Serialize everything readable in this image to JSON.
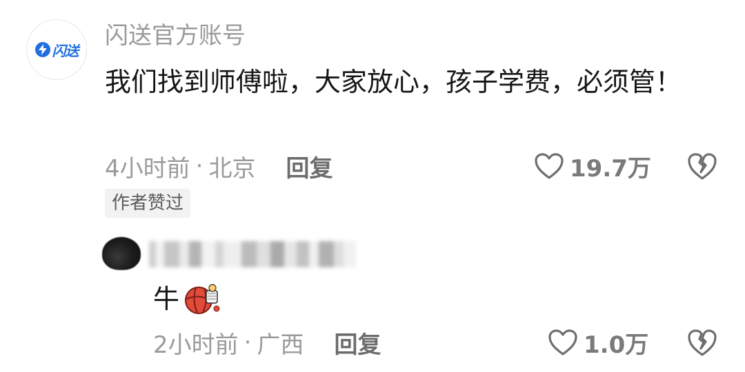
{
  "comment": {
    "avatar": {
      "icon": "shansong-logo-icon",
      "logo_text": "闪送",
      "brand_color": "#1f6fe0"
    },
    "username": "闪送官方账号",
    "text": "我们找到师傅啦，大家放心，孩子学费，必须管！",
    "time": "4小时前",
    "separator": "·",
    "location": "北京",
    "reply_label": "回复",
    "like_icon": "heart-outline-icon",
    "like_count": "19.7万",
    "dislike_icon": "broken-heart-icon",
    "author_badge": "作者赞过"
  },
  "reply": {
    "avatar_icon": "blurred-avatar",
    "username_blurred": true,
    "text": "牛",
    "emoji": "basketball-dunk-emoji",
    "time": "2小时前",
    "separator": "·",
    "location": "广西",
    "reply_label": "回复",
    "like_icon": "heart-outline-icon",
    "like_count": "1.0万",
    "dislike_icon": "broken-heart-icon"
  },
  "colors": {
    "text_primary": "#161616",
    "text_secondary": "#9a9a9a",
    "badge_bg": "#f2f2f2",
    "icon_gray": "#6e6e6e"
  }
}
